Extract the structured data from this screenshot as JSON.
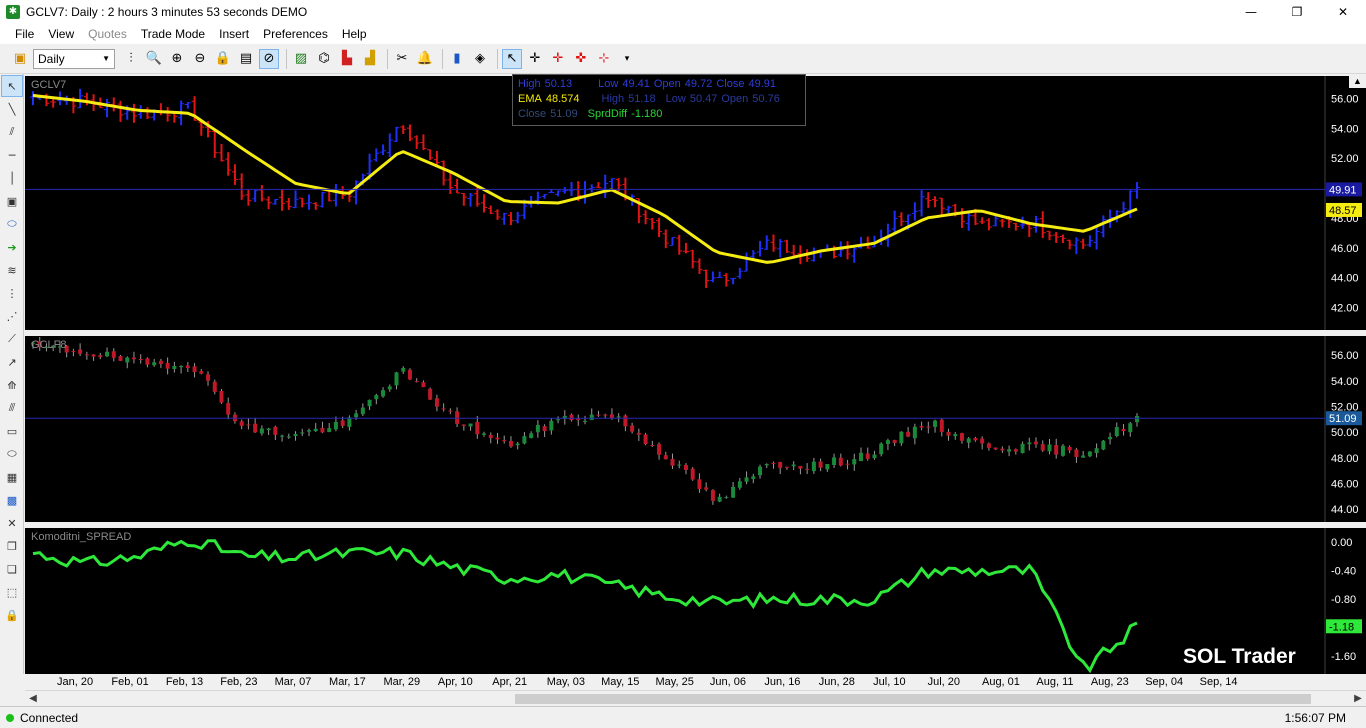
{
  "window": {
    "title": "GCLV7: Daily : 2 hours 3 minutes 53 seconds DEMO",
    "minimize": "—",
    "maximize": "❐",
    "close": "✕"
  },
  "menu": {
    "items": [
      "File",
      "View",
      "Quotes",
      "Trade Mode",
      "Insert",
      "Preferences",
      "Help"
    ]
  },
  "toolbar": {
    "interval_value": "Daily"
  },
  "data_window": {
    "row1": {
      "high_label": "High",
      "high": "50.13",
      "low_label": "Low",
      "low": "49.41",
      "open_label": "Open",
      "open": "49.72",
      "close_label": "Close",
      "close": "49.91"
    },
    "row2": {
      "ema_label": "EMA",
      "ema": "48.574",
      "high_label": "High",
      "high": "51.18",
      "low_label": "Low",
      "low": "50.47",
      "open_label": "Open",
      "open": "50.76"
    },
    "row3": {
      "close_label": "Close",
      "close": "51.09",
      "spread_label": "SprdDiff",
      "spread": "-1.180"
    }
  },
  "watermark": "SOL Trader",
  "status": {
    "connection": "Connected",
    "time": "1:56:07 PM"
  },
  "colors": {
    "up_bar": "#1f2ff5",
    "down_bar": "#e01515",
    "ema_line": "#f5ec12",
    "spread_line": "#2ee83a",
    "candle_up": "#1a8a3a",
    "candle_down": "#c01828",
    "last_price_line": "#2828b4"
  },
  "chart_data": [
    {
      "type": "bar",
      "name": "GCLV7",
      "ylim": [
        40.5,
        57.5
      ],
      "yticks": [
        42.0,
        44.0,
        46.0,
        48.0,
        50.0,
        52.0,
        54.0,
        56.0
      ],
      "last_value": 49.91,
      "last_label": "49.91",
      "ema_label": "48.57",
      "x": [
        "Jan, 20",
        "Feb, 01",
        "Feb, 13",
        "Feb, 23",
        "Mar, 07",
        "Mar, 17",
        "Mar, 29",
        "Apr, 10",
        "Apr, 21",
        "May, 03",
        "May, 15",
        "May, 25",
        "Jun, 06",
        "Jun, 16",
        "Jun, 28",
        "Jul, 10",
        "Jul, 20",
        "Aug, 01",
        "Aug, 11",
        "Aug, 23",
        "Sep, 04",
        "Sep, 14"
      ],
      "close": [
        56.1,
        55.8,
        55.0,
        55.3,
        49.5,
        49.0,
        49.6,
        54.5,
        49.8,
        48.0,
        49.6,
        50.5,
        46.8,
        43.5,
        46.3,
        45.5,
        46.5,
        49.6,
        47.5,
        47.7,
        46.2,
        49.9
      ],
      "ema": [
        56.2,
        55.8,
        55.2,
        55.0,
        52.6,
        50.3,
        49.6,
        52.5,
        51.0,
        49.1,
        49.0,
        49.9,
        48.2,
        45.7,
        45.0,
        45.8,
        46.3,
        48.0,
        48.5,
        47.6,
        47.1,
        48.6
      ],
      "series_labels": [
        "EMA"
      ]
    },
    {
      "type": "bar",
      "name": "GCLF8",
      "ylim": [
        43.0,
        57.5
      ],
      "yticks": [
        44.0,
        46.0,
        48.0,
        50.0,
        52.0,
        54.0,
        56.0
      ],
      "last_value": 51.09,
      "last_label": "51.09",
      "x": [
        "Jan, 20",
        "Feb, 01",
        "Feb, 13",
        "Feb, 23",
        "Mar, 07",
        "Mar, 17",
        "Mar, 29",
        "Apr, 10",
        "Apr, 21",
        "May, 03",
        "May, 15",
        "May, 25",
        "Jun, 06",
        "Jun, 16",
        "Jun, 28",
        "Jul, 10",
        "Jul, 20",
        "Aug, 01",
        "Aug, 11",
        "Aug, 23",
        "Sep, 04",
        "Sep, 14"
      ],
      "close": [
        56.6,
        56.3,
        55.3,
        55.4,
        50.3,
        49.8,
        50.7,
        54.8,
        51.1,
        48.9,
        51.0,
        51.4,
        48.3,
        44.5,
        47.6,
        47.4,
        48.4,
        50.8,
        49.0,
        48.8,
        48.4,
        51.1
      ]
    },
    {
      "type": "line",
      "name": "Komoditni_SPREAD",
      "ylim": [
        -1.85,
        0.2
      ],
      "yticks": [
        -1.6,
        -1.2,
        -0.8,
        -0.4,
        0.0
      ],
      "ytick_labels": [
        "-1.60",
        "-1.20",
        "-0.80",
        "-0.40",
        "0.00"
      ],
      "last_value": -1.18,
      "last_label": "-1.18",
      "x": [
        "Jan, 20",
        "Feb, 01",
        "Feb, 13",
        "Feb, 23",
        "Mar, 07",
        "Mar, 17",
        "Mar, 29",
        "Apr, 10",
        "Apr, 21",
        "May, 03",
        "May, 15",
        "May, 25",
        "Jun, 06",
        "Jun, 16",
        "Jun, 28",
        "Jul, 10",
        "Jul, 20",
        "Aug, 01",
        "Aug, 11",
        "Aug, 23",
        "Sep, 04",
        "Sep, 14"
      ],
      "values": [
        -0.15,
        -0.3,
        -0.2,
        0.05,
        -0.2,
        -0.22,
        -0.15,
        -0.15,
        -0.35,
        -0.5,
        -0.45,
        -0.6,
        -0.75,
        -0.85,
        -0.8,
        -0.8,
        -0.8,
        -0.4,
        -0.4,
        -0.4,
        -1.8,
        -1.18
      ]
    }
  ]
}
